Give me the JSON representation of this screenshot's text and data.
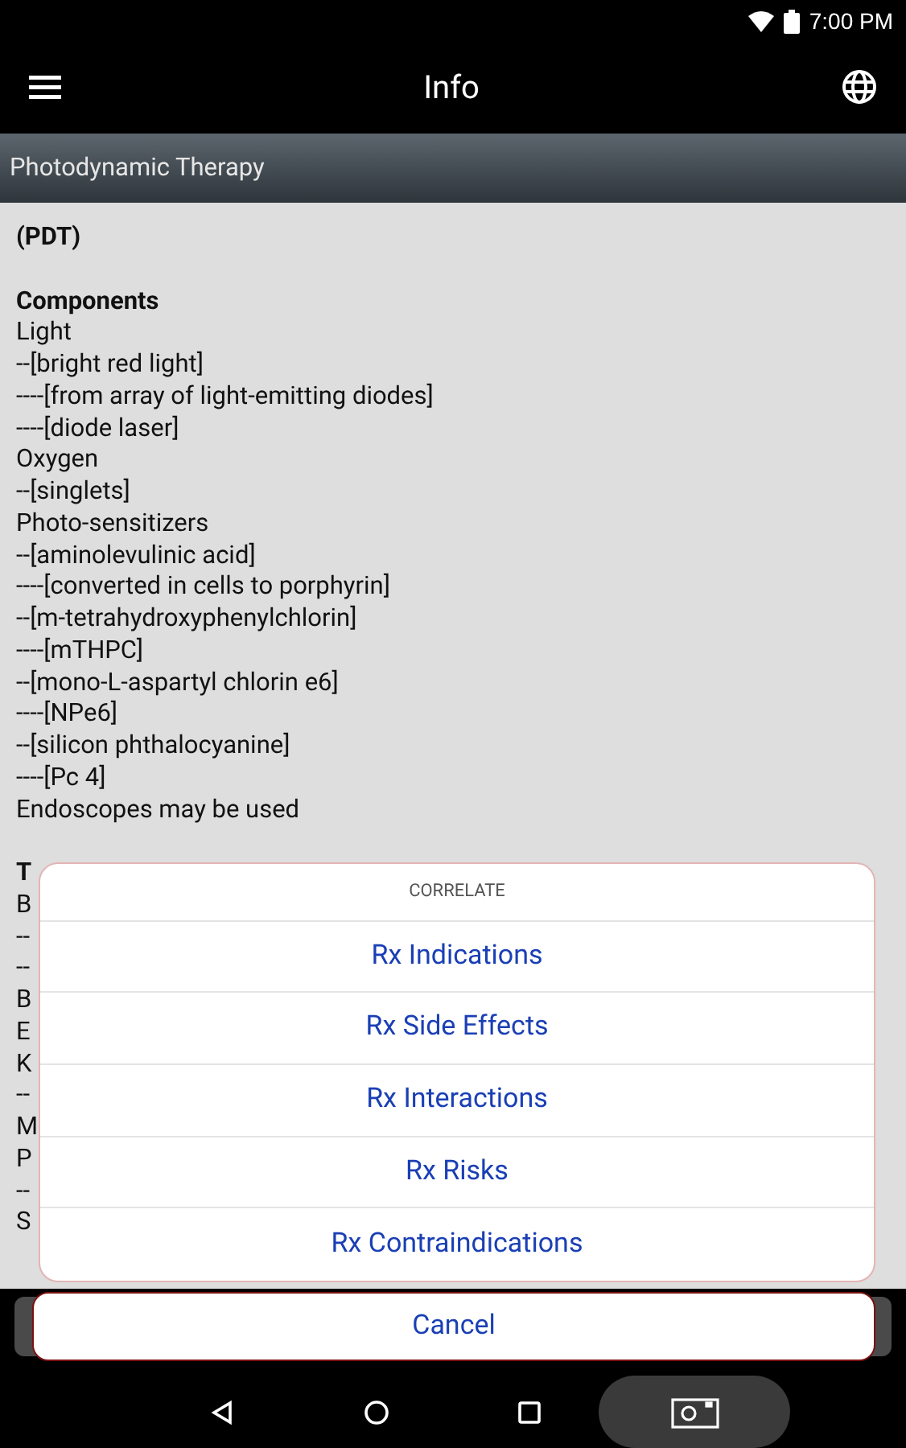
{
  "status_bar": {
    "time": "7:00 PM"
  },
  "app_bar": {
    "title": "Info"
  },
  "section_header": "Photodynamic Therapy",
  "content": [
    {
      "heading": "(PDT)"
    },
    {
      "heading": "Components",
      "lines": [
        "Light",
        "--[bright red light]",
        "----[from array of light-emitting diodes]",
        "----[diode laser]",
        "Oxygen",
        "--[singlets]",
        "Photo-sensitizers",
        "--[aminolevulinic acid]",
        "----[converted in cells to porphyrin]",
        "--[m-tetrahydroxyphenylchlorin]",
        "----[mTHPC]",
        "--[mono-L-aspartyl chlorin e6]",
        "----[NPe6]",
        "--[silicon phthalocyanine]",
        "----[Pc 4]",
        "Endoscopes may be used"
      ]
    },
    {
      "heading": "T",
      "lines": [
        "B",
        "--",
        "--",
        "B",
        "E",
        "K",
        "--",
        "M",
        "P",
        "--",
        "S"
      ]
    }
  ],
  "dialog": {
    "title": "CORRELATE",
    "options": [
      "Rx Indications",
      "Rx Side Effects",
      "Rx Interactions",
      "Rx Risks",
      "Rx Contraindications"
    ],
    "cancel": "Cancel"
  }
}
